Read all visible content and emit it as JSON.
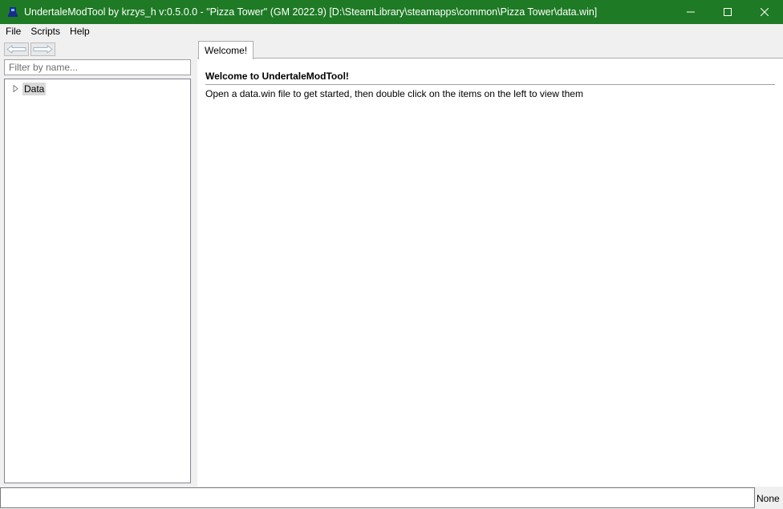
{
  "window": {
    "title": "UndertaleModTool by krzys_h v:0.5.0.0 - \"Pizza Tower\" (GM 2022.9) [D:\\SteamLibrary\\steamapps\\common\\Pizza Tower\\data.win]",
    "titlebar_color": "#1e7a24",
    "icons": [
      "app-icon",
      "minimize-icon",
      "maximize-icon",
      "close-icon"
    ]
  },
  "menu": {
    "items": [
      "File",
      "Scripts",
      "Help"
    ]
  },
  "sidebar": {
    "filter_placeholder": "Filter by name...",
    "tree_root": "Data",
    "icons": [
      "back-arrow-icon",
      "forward-arrow-icon",
      "expand-triangle-icon"
    ]
  },
  "tabs": [
    {
      "label": "Welcome!",
      "active": true
    }
  ],
  "welcome": {
    "heading": "Welcome to UndertaleModTool!",
    "body": "Open a data.win file to get started, then double click on the items on the left to view them"
  },
  "status": {
    "label": "None",
    "command_value": ""
  }
}
